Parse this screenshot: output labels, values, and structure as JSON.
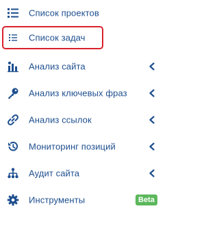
{
  "colors": {
    "text": "#1e4f8f",
    "icon": "#1e4f8f",
    "highlight": "#d9212c",
    "badge": "#5cb85c"
  },
  "menu": {
    "items": [
      {
        "label": "Список проектов",
        "icon": "grid-list-icon",
        "expandable": false
      },
      {
        "label": "Список задач",
        "icon": "list-icon",
        "expandable": false,
        "highlighted": true
      },
      {
        "label": "Анализ сайта",
        "icon": "bar-chart-icon",
        "expandable": true
      },
      {
        "label": "Анализ ключевых фраз",
        "icon": "key-icon",
        "expandable": true
      },
      {
        "label": "Анализ ссылок",
        "icon": "link-icon",
        "expandable": true
      },
      {
        "label": "Мониторинг позиций",
        "icon": "history-icon",
        "expandable": true
      },
      {
        "label": "Аудит сайта",
        "icon": "sitemap-icon",
        "expandable": true
      },
      {
        "label": "Инструменты",
        "icon": "gear-icon",
        "expandable": false,
        "badge": "Beta"
      }
    ]
  }
}
